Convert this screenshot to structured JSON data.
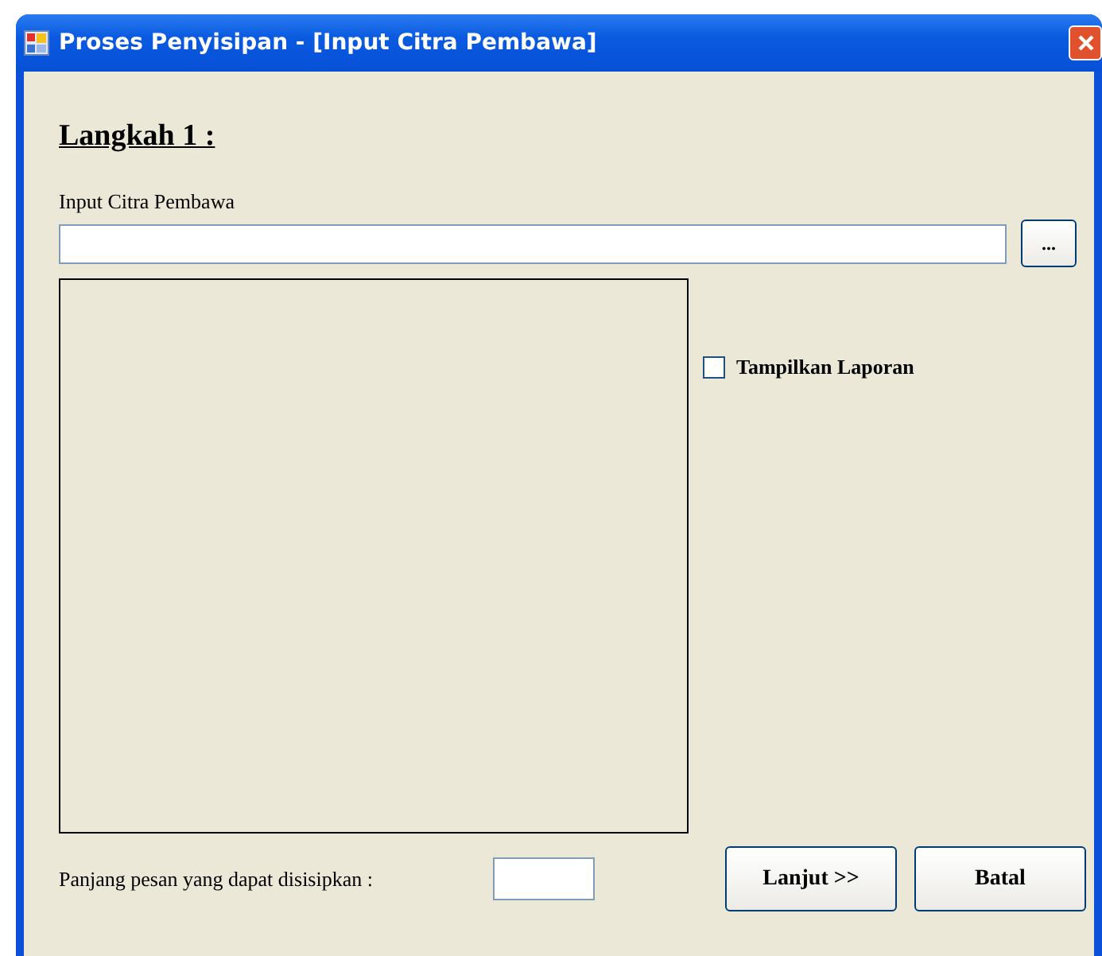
{
  "window": {
    "title": "Proses Penyisipan - [Input Citra Pembawa]"
  },
  "heading": "Langkah 1 :",
  "input": {
    "label": "Input Citra Pembawa",
    "browse_button": "..."
  },
  "report_checkbox": {
    "label": "Tampilkan Laporan",
    "checked": false
  },
  "capacity": {
    "label": "Panjang pesan yang dapat disisipkan :"
  },
  "next_button": "Lanjut >>",
  "cancel_button": "Batal"
}
